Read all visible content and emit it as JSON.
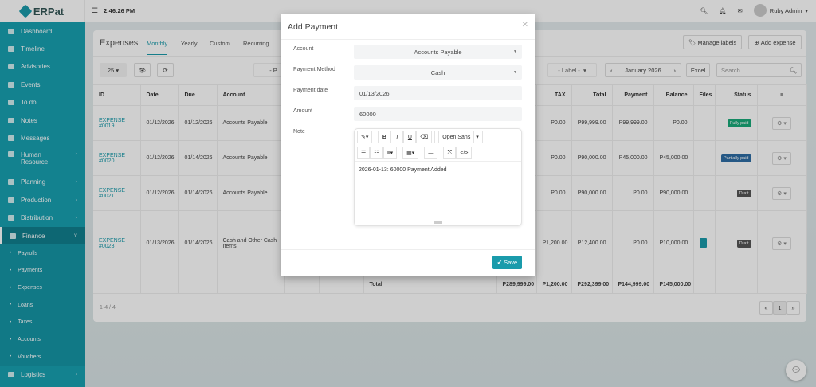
{
  "app": {
    "logo": "ERPat",
    "clock": "2:46:26 PM",
    "user": "Ruby Admin"
  },
  "sidebar": [
    {
      "label": "Dashboard"
    },
    {
      "label": "Timeline"
    },
    {
      "label": "Advisories"
    },
    {
      "label": "Events"
    },
    {
      "label": "To do"
    },
    {
      "label": "Notes"
    },
    {
      "label": "Messages"
    },
    {
      "label": "Human Resource"
    },
    {
      "label": "Planning"
    },
    {
      "label": "Production"
    },
    {
      "label": "Distribution"
    },
    {
      "label": "Finance"
    }
  ],
  "finance_sub": [
    "Payrolls",
    "Payments",
    "Expenses",
    "Loans",
    "Taxes",
    "Accounts",
    "Vouchers"
  ],
  "logistics": "Logistics",
  "page": {
    "title": "Expenses",
    "tabs": [
      "Monthly",
      "Yearly",
      "Custom",
      "Recurring"
    ],
    "manage_labels": "Manage labels",
    "add_expense": "Add expense",
    "page_size": "25",
    "label_filter": "- Label -",
    "partial_filter": "- P",
    "month": "January 2026",
    "excel": "Excel",
    "search_placeholder": "Search",
    "count": "1-4 / 4",
    "page": "1"
  },
  "table": {
    "headers": {
      "id": "ID",
      "date": "Date",
      "due": "Due",
      "account": "Account",
      "tax": "TAX",
      "total": "Total",
      "payment": "Payment",
      "balance": "Balance",
      "files": "Files",
      "status": "Status"
    },
    "rows": [
      {
        "id1": "EXPENSE",
        "id2": "#0019",
        "date": "01/12/2026",
        "due": "01/12/2026",
        "account": "Accounts Payable",
        "tax": "P0.00",
        "total": "P99,999.00",
        "payment": "P99,999.00",
        "balance": "P0.00",
        "status": "Fully paid",
        "status_color": "#19a979"
      },
      {
        "id1": "EXPENSE",
        "id2": "#0020",
        "date": "01/12/2026",
        "due": "01/14/2026",
        "account": "Accounts Payable",
        "tax": "P0.00",
        "total": "P90,000.00",
        "payment": "P45,000.00",
        "balance": "P45,000.00",
        "status": "Partially paid",
        "status_color": "#2e6da4"
      },
      {
        "id1": "EXPENSE",
        "id2": "#0021",
        "date": "01/12/2026",
        "due": "01/14/2026",
        "account": "Accounts Payable",
        "tax": "P0.00",
        "total": "P90,000.00",
        "payment": "P0.00",
        "balance": "P90,000.00",
        "status": "Draft",
        "status_color": "#555555"
      },
      {
        "id1": "EXPENSE",
        "id2": "#0023",
        "date": "01/13/2026",
        "due": "01/14/2026",
        "account": "Cash and Other Cash Items",
        "tax": "P1,200.00",
        "total": "P12,400.00",
        "payment": "P0.00",
        "balance": "P10,000.00",
        "status": "Draft",
        "status_color": "#555555"
      }
    ],
    "totals": {
      "label": "Total",
      "amount": "P289,999.00",
      "tax": "P1,200.00",
      "total": "P292,399.00",
      "payment": "P144,999.00",
      "balance": "P145,000.00"
    }
  },
  "modal": {
    "title": "Add Payment",
    "account_label": "Account",
    "account": "Accounts Payable",
    "method_label": "Payment Method",
    "method": "Cash",
    "date_label": "Payment date",
    "date": "01/13/2026",
    "amount_label": "Amount",
    "amount": "60000",
    "note_label": "Note",
    "font": "Open Sans",
    "note": "2026-01-13: 60000 Payment Added",
    "save": "Save"
  }
}
